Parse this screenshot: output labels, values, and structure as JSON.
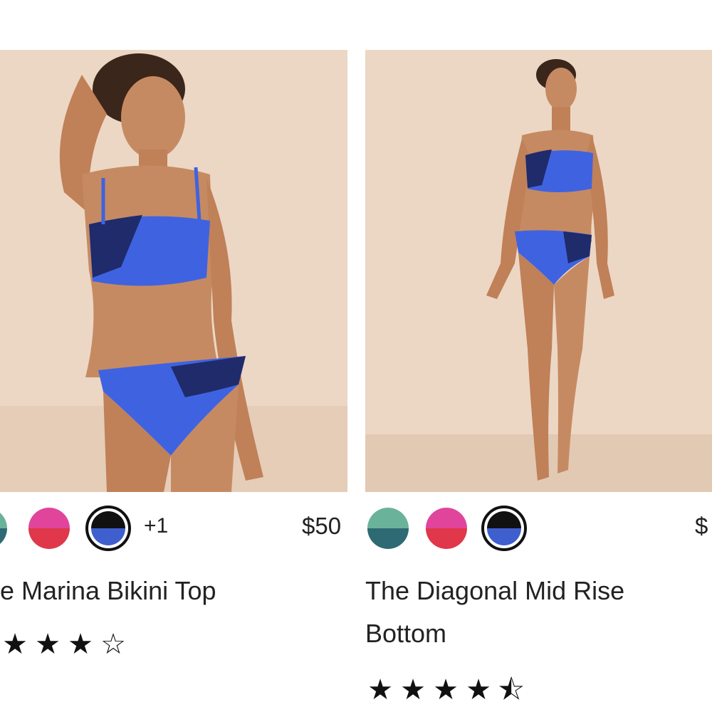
{
  "products": [
    {
      "title": "The Marina Bikini Top",
      "title_visible": "e Marina Bikini Top",
      "price": "$50",
      "more_colors": "+1",
      "rating_stars": 4,
      "rating_max": 5,
      "swatches": [
        {
          "name": "teal",
          "top": "#6ab39a",
          "bottom": "#2e6a73",
          "selected": false
        },
        {
          "name": "pink-red",
          "top": "#e0459b",
          "bottom": "#e0374b",
          "selected": false
        },
        {
          "name": "black-blue",
          "top": "#111111",
          "bottom": "#3f5fcf",
          "selected": true
        }
      ]
    },
    {
      "title_line1": "The Diagonal Mid Rise",
      "title_line2": "Bottom",
      "price": "$",
      "rating_stars": 4.5,
      "rating_max": 5,
      "swatches": [
        {
          "name": "teal",
          "top": "#6ab39a",
          "bottom": "#2e6a73",
          "selected": false
        },
        {
          "name": "pink-red",
          "top": "#e0459b",
          "bottom": "#e0374b",
          "selected": false
        },
        {
          "name": "black-blue",
          "top": "#111111",
          "bottom": "#3f5fcf",
          "selected": true
        }
      ]
    }
  ],
  "glyphs": {
    "star_full": "★",
    "star_empty": "☆",
    "star_half": "⯪"
  },
  "colors": {
    "photo_bg": "#ecd7c5",
    "swim_blue": "#3f63e0",
    "swim_navy": "#1f2b6b",
    "skin": "#c98a62"
  }
}
